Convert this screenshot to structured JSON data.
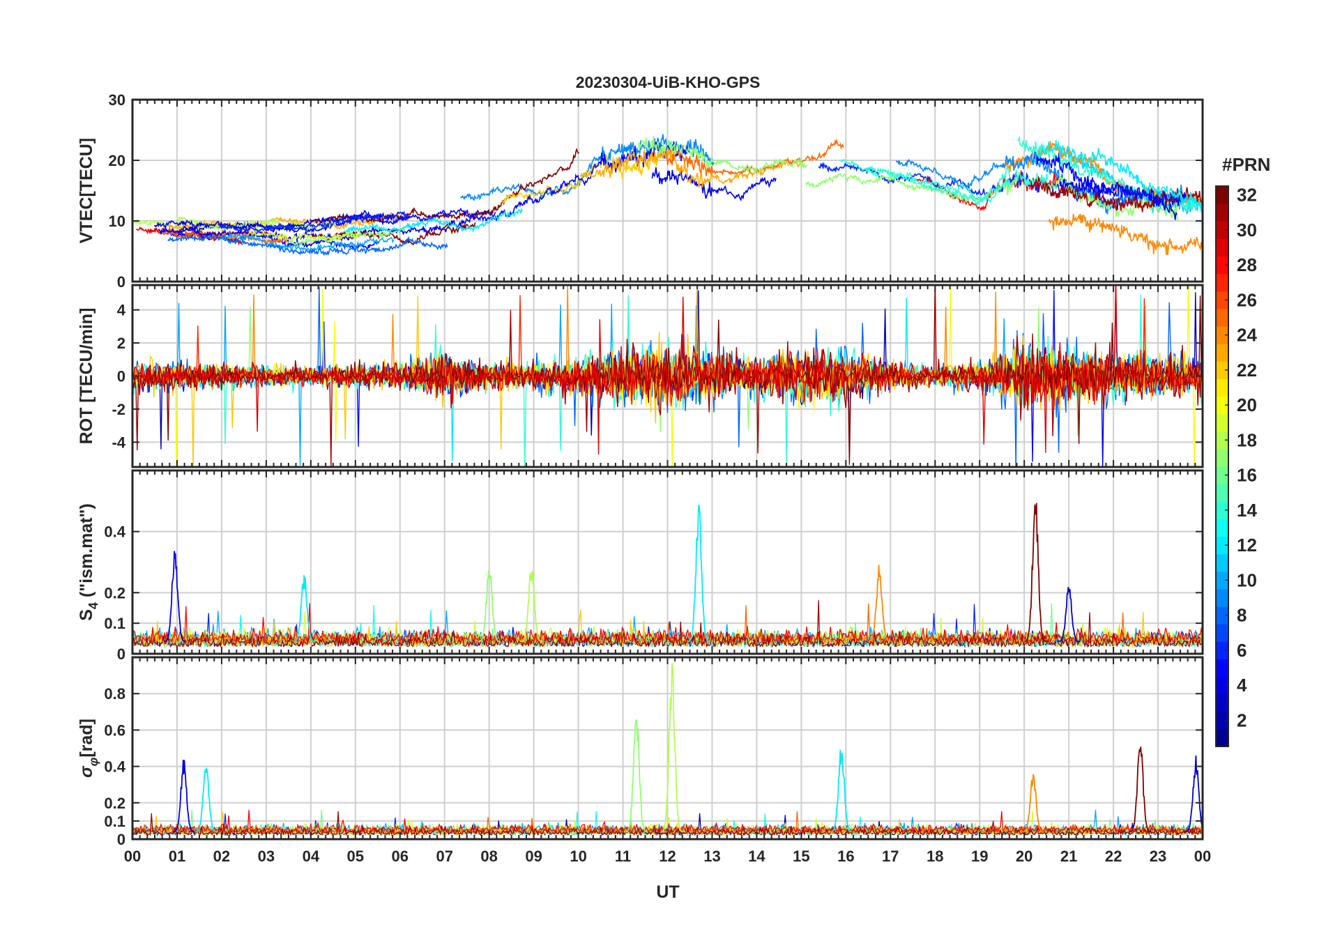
{
  "chart_data": [
    {
      "type": "line",
      "title": "20230304-UiB-KHO-GPS",
      "ylabel": "VTEC[TECU]",
      "xlabel": "",
      "xlim": [
        0,
        24
      ],
      "ylim": [
        0,
        30
      ],
      "yticks": [
        0,
        10,
        20,
        30
      ],
      "grid": true,
      "series_style": "many PRN traces, colored by #PRN",
      "series_envelope": {
        "x_hours": [
          0,
          2,
          4,
          6,
          8,
          9,
          10,
          11,
          12,
          13,
          14,
          15,
          16,
          17,
          18,
          19,
          20,
          21,
          22,
          23,
          24
        ],
        "mid": [
          9.5,
          9,
          8.5,
          10,
          11,
          13,
          15,
          17,
          18,
          16,
          17,
          18,
          19,
          18,
          16,
          14,
          18,
          16,
          13,
          12,
          11
        ],
        "spread": [
          3,
          3,
          3,
          4,
          5,
          6,
          7,
          8,
          8,
          6,
          5,
          5,
          5,
          5,
          5,
          6,
          8,
          7,
          6,
          5,
          5
        ]
      }
    },
    {
      "type": "line",
      "ylabel": "ROT [TECU/min]",
      "xlim": [
        0,
        24
      ],
      "ylim": [
        -5.5,
        5.5
      ],
      "yticks": [
        -4,
        -2,
        0,
        2,
        4
      ],
      "grid": true,
      "series_envelope": {
        "x_hours": [
          0,
          2,
          4,
          6,
          7,
          8,
          10,
          11,
          12,
          13,
          14,
          15,
          16,
          17,
          18,
          19,
          20,
          21,
          22,
          23,
          24
        ],
        "amplitude": [
          1.5,
          1.2,
          1.0,
          1.3,
          2.5,
          1.2,
          2.0,
          3.0,
          3.5,
          2.5,
          2.0,
          3.0,
          3.0,
          1.5,
          1.0,
          1.5,
          3.5,
          3.0,
          2.5,
          2.5,
          2.0
        ]
      }
    },
    {
      "type": "line",
      "ylabel": "S4 (\"ism.mat\")",
      "ylabel_main": "S",
      "ylabel_sub": "4",
      "ylabel_rest": "(\"ism.mat\")",
      "xlim": [
        0,
        24
      ],
      "ylim": [
        0,
        0.6
      ],
      "yticks": [
        0,
        0.1,
        0.2,
        0.4
      ],
      "ytick_labels": [
        "0",
        "0.1",
        "0.2",
        "0.4"
      ],
      "grid": true,
      "baseline": 0.04,
      "peaks": [
        {
          "x": 0.95,
          "y": 0.36
        },
        {
          "x": 3.85,
          "y": 0.27
        },
        {
          "x": 8.0,
          "y": 0.3
        },
        {
          "x": 8.95,
          "y": 0.3
        },
        {
          "x": 12.7,
          "y": 0.5
        },
        {
          "x": 16.75,
          "y": 0.3
        },
        {
          "x": 20.25,
          "y": 0.54
        },
        {
          "x": 21.0,
          "y": 0.23
        }
      ]
    },
    {
      "type": "line",
      "ylabel": "σφ[rad]",
      "ylabel_main": "σ",
      "ylabel_sub": "φ",
      "ylabel_rest": "[rad]",
      "xlabel": "UT",
      "xlim": [
        0,
        24
      ],
      "ylim": [
        0,
        1.0
      ],
      "yticks": [
        0,
        0.1,
        0.2,
        0.4,
        0.6,
        0.8
      ],
      "ytick_labels": [
        "0",
        "0.1",
        "0.2",
        "0.4",
        "0.6",
        "0.8"
      ],
      "xtick_labels": [
        "00",
        "01",
        "02",
        "03",
        "04",
        "05",
        "06",
        "07",
        "08",
        "09",
        "10",
        "11",
        "12",
        "13",
        "14",
        "15",
        "16",
        "17",
        "18",
        "19",
        "20",
        "21",
        "22",
        "23",
        "00"
      ],
      "grid": true,
      "baseline": 0.04,
      "peaks": [
        {
          "x": 1.15,
          "y": 0.45
        },
        {
          "x": 1.65,
          "y": 0.45
        },
        {
          "x": 11.3,
          "y": 0.74
        },
        {
          "x": 12.1,
          "y": 1.0
        },
        {
          "x": 15.9,
          "y": 0.54
        },
        {
          "x": 20.2,
          "y": 0.38
        },
        {
          "x": 22.6,
          "y": 0.57
        },
        {
          "x": 23.85,
          "y": 0.46
        }
      ]
    }
  ],
  "colorbar": {
    "label": "#PRN",
    "min": 1,
    "max": 32,
    "ticks": [
      2,
      4,
      6,
      8,
      10,
      12,
      14,
      16,
      18,
      20,
      22,
      24,
      26,
      28,
      30,
      32
    ],
    "colormap": "jet",
    "colors": [
      "#00008f",
      "#0000ff",
      "#0080ff",
      "#00ffff",
      "#80ff80",
      "#ffff00",
      "#ff8000",
      "#ff0000",
      "#800000"
    ]
  }
}
